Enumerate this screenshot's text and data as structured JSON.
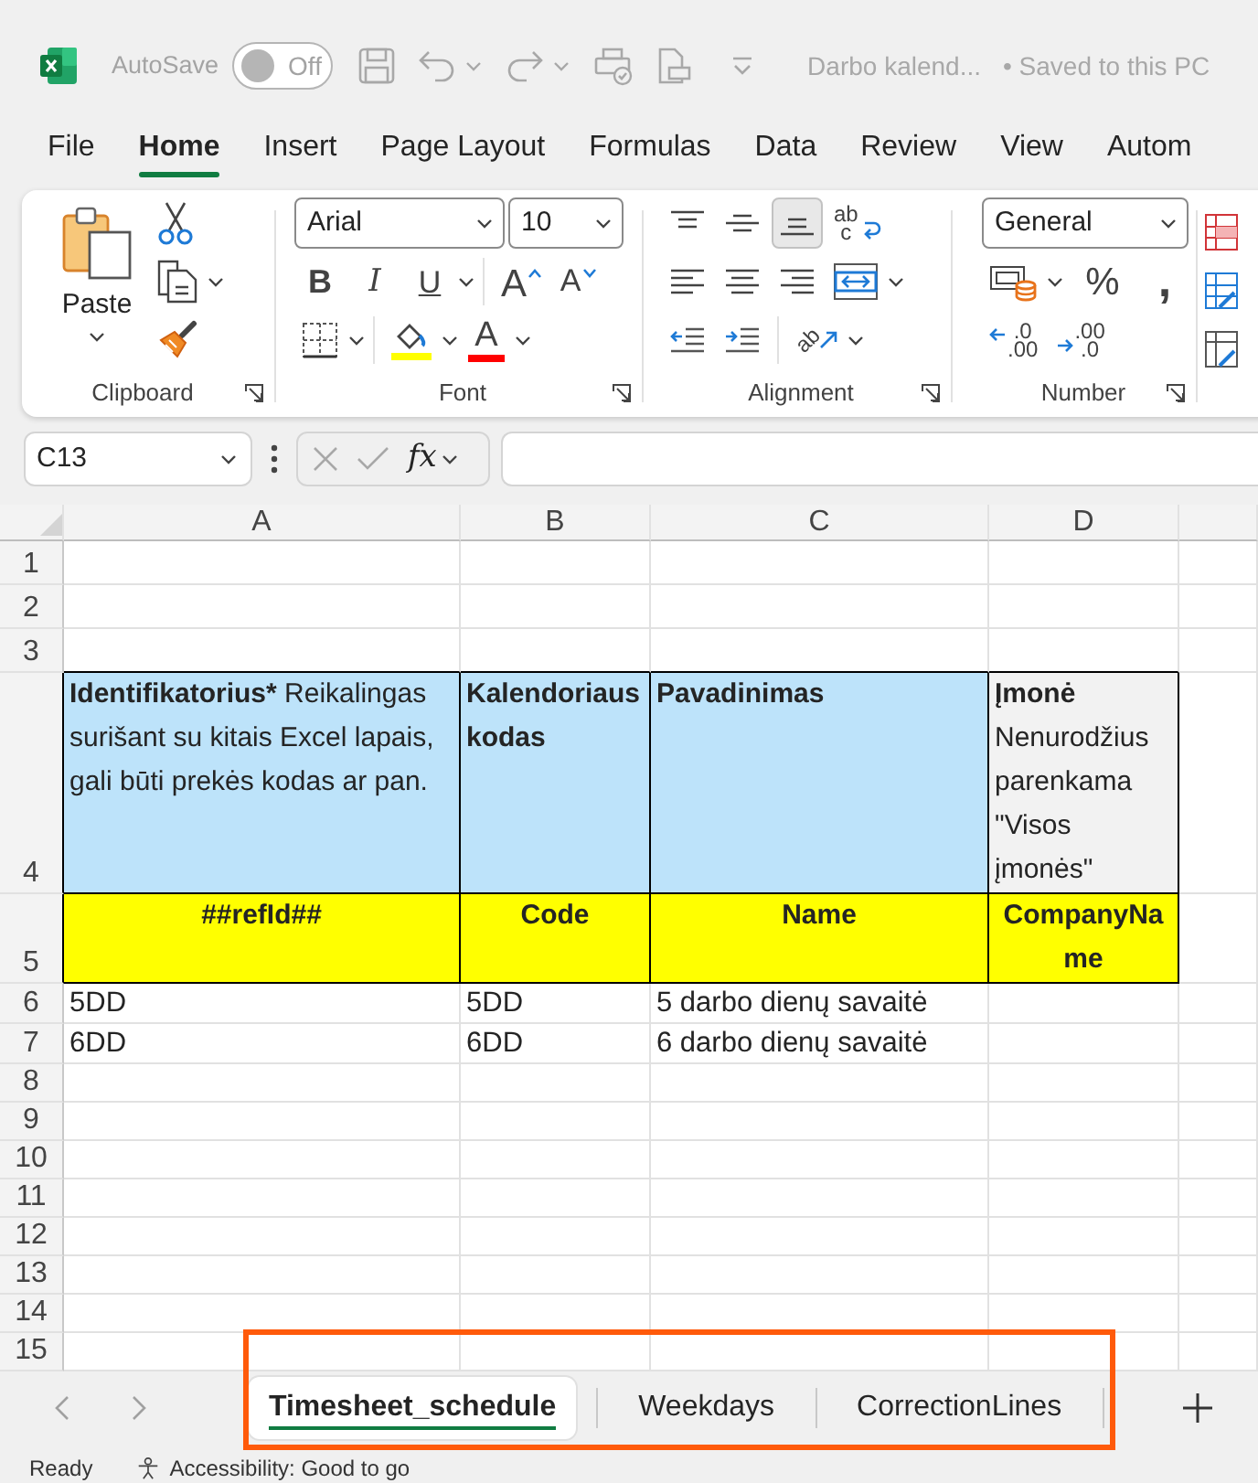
{
  "title_bar": {
    "autosave_label": "AutoSave",
    "autosave": {
      "on": false,
      "label": "Off"
    },
    "file_name": "Darbo kalend...",
    "save_status": "• Saved to this PC"
  },
  "menu_tabs": [
    {
      "label": "File",
      "selected": false
    },
    {
      "label": "Home",
      "selected": true
    },
    {
      "label": "Insert",
      "selected": false
    },
    {
      "label": "Page Layout",
      "selected": false
    },
    {
      "label": "Formulas",
      "selected": false
    },
    {
      "label": "Data",
      "selected": false
    },
    {
      "label": "Review",
      "selected": false
    },
    {
      "label": "View",
      "selected": false
    },
    {
      "label": "Autom",
      "selected": false
    }
  ],
  "ribbon": {
    "clipboard": {
      "paste_label": "Paste",
      "group_label": "Clipboard"
    },
    "font": {
      "font_name": "Arial",
      "font_size": "10",
      "style_buttons": [
        {
          "kind": "bold",
          "glyph": "B"
        },
        {
          "kind": "italic",
          "glyph": "I"
        },
        {
          "kind": "underline",
          "glyph": "U"
        }
      ],
      "size_buttons": [
        {
          "kind": "grow",
          "glyph": "A"
        },
        {
          "kind": "shrink",
          "glyph": "A"
        }
      ],
      "font_color_glyph": "A",
      "group_label": "Font"
    },
    "alignment": {
      "vertical_buttons": [
        {
          "kind": "top",
          "selected": false
        },
        {
          "kind": "middle",
          "selected": false
        },
        {
          "kind": "bottom",
          "selected": true
        }
      ],
      "wrap_glyphs": [
        "ab",
        "c"
      ],
      "horizontal_buttons": [
        {
          "kind": "left",
          "selected": false
        },
        {
          "kind": "center",
          "selected": false
        },
        {
          "kind": "right",
          "selected": false
        }
      ],
      "orientation_glyph": "ab",
      "group_label": "Alignment"
    },
    "number": {
      "format": "General",
      "percent_glyph": "%",
      "comma_glyph": ",",
      "decimal_buttons": [
        {
          "kind": "increase",
          "glyphs": [
            ".0",
            ".00"
          ]
        },
        {
          "kind": "decrease",
          "glyphs": [
            ".00",
            ".0"
          ]
        }
      ],
      "group_label": "Number"
    }
  },
  "formula_bar": {
    "name_box": "C13",
    "fx_glyph": "fx"
  },
  "sheet": {
    "columns": [
      "A",
      "B",
      "C",
      "D"
    ],
    "rows": [
      {
        "number": "1",
        "kind": "spacer"
      },
      {
        "number": "2",
        "kind": "spacer"
      },
      {
        "number": "3",
        "kind": "spacer"
      },
      {
        "number": "4",
        "kind": "description",
        "cells": [
          {
            "title": "Identifikatorius*",
            "note": "Reikalingas surišant su kitais Excel lapais, gali būti prekės kodas ar pan.",
            "color": "#bde3fa"
          },
          {
            "title": "Kalendoriaus kodas",
            "color": "#bde3fa"
          },
          {
            "title": "Pavadinimas",
            "color": "#bde3fa"
          },
          {
            "title": "Įmonė",
            "note": "Nenurodžius parenkama \"Visos įmonės\"",
            "color": "#f2f2f2"
          }
        ]
      },
      {
        "number": "5",
        "kind": "field",
        "cells": [
          "##refId##",
          "Code",
          "Name",
          "CompanyName"
        ]
      },
      {
        "number": "6",
        "kind": "data",
        "cells": [
          "5DD",
          "5DD",
          "5 darbo dienų savaitė"
        ]
      },
      {
        "number": "7",
        "kind": "data",
        "cells": [
          "6DD",
          "6DD",
          "6 darbo dienų savaitė"
        ]
      },
      {
        "number": "8",
        "kind": "empty"
      },
      {
        "number": "9",
        "kind": "empty"
      },
      {
        "number": "10",
        "kind": "empty"
      },
      {
        "number": "11",
        "kind": "empty"
      },
      {
        "number": "12",
        "kind": "empty"
      },
      {
        "number": "13",
        "kind": "empty"
      },
      {
        "number": "14",
        "kind": "empty"
      },
      {
        "number": "15",
        "kind": "empty"
      }
    ]
  },
  "sheet_tabs": [
    {
      "label": "Timesheet_schedule",
      "selected": true
    },
    {
      "label": "Weekdays",
      "selected": false
    },
    {
      "label": "CorrectionLines",
      "selected": false
    }
  ],
  "status_bar": {
    "status": "Ready",
    "accessibility": "Accessibility: Good to go"
  }
}
